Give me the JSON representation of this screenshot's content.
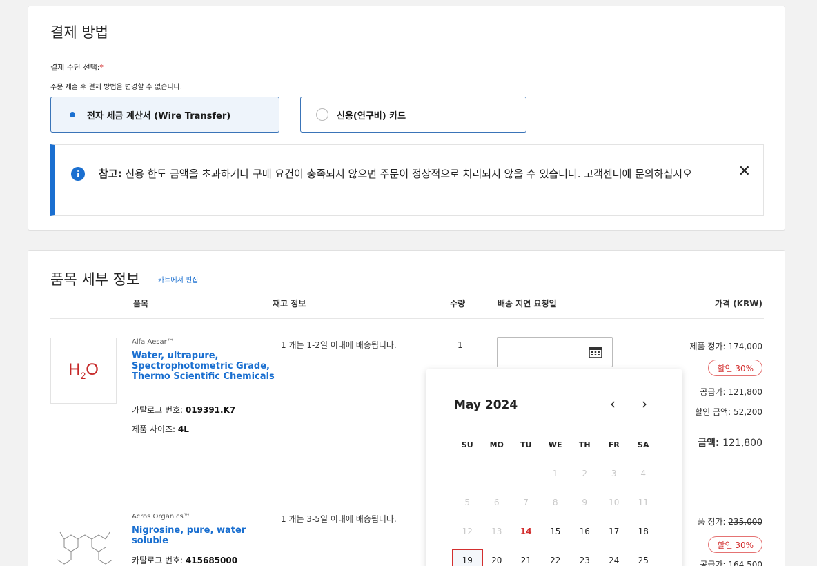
{
  "payment": {
    "title": "결제 방법",
    "select_label": "결제 수단 선택:",
    "required_mark": "*",
    "note": "주문 제출 후 결제 방법을 변경할 수 없습니다.",
    "option_wire": "전자 세금 계산서 (Wire Transfer)",
    "option_card": "신용(연구비) 카드",
    "notice_label": "참고:",
    "notice_text": "신용 한도 금액을 초과하거나 구매 요건이 충족되지 않으면 주문이 정상적으로 처리되지 않을 수 있습니다. 고객센터에 문의하십시오",
    "close_glyph": "✕",
    "info_glyph": "i"
  },
  "items": {
    "title": "품목 세부 정보",
    "edit_link": "카트에서 편집",
    "headers": {
      "item": "품목",
      "stock": "재고 정보",
      "qty": "수량",
      "delivery": "배송 지연 요청일",
      "price": "가격 (KRW)"
    },
    "products": [
      {
        "brand": "Alfa Aesar™",
        "name": "Water, ultrapure, Spectrophotometric Grade, Thermo Scientific Chemicals",
        "catalog_label": "카탈로그 번호:",
        "catalog": "019391.K7",
        "size_label": "제품 사이즈:",
        "size": "4L",
        "stock": "1 개는 1-2일 이내에 배송됩니다.",
        "qty": "1",
        "list_label": "제품 정가:",
        "list_price": "174,000",
        "discount": "할인 30%",
        "supply_label": "공급가:",
        "supply": "121,800",
        "discount_amt_label": "할인 금액:",
        "discount_amt": "52,200",
        "total_label": "금액:",
        "total": "121,800"
      },
      {
        "brand": "Acros Organics™",
        "name": "Nigrosine, pure, water soluble",
        "catalog_label": "카탈로그 번호:",
        "catalog": "415685000",
        "stock": "1 개는 3-5일 이내에 배송됩니다.",
        "list_label": "품 정가:",
        "list_price": "235,000",
        "discount": "할인 30%",
        "supply_label": "공급가:",
        "supply": "164,500"
      }
    ]
  },
  "calendar": {
    "month": "May 2024",
    "prev": "‹",
    "next": "›",
    "weekdays": [
      "SU",
      "MO",
      "TU",
      "WE",
      "TH",
      "FR",
      "SA"
    ],
    "weeks": [
      [
        "",
        "",
        "",
        "1",
        "2",
        "3",
        "4"
      ],
      [
        "5",
        "6",
        "7",
        "8",
        "9",
        "10",
        "11"
      ],
      [
        "12",
        "13",
        "14",
        "15",
        "16",
        "17",
        "18"
      ],
      [
        "19",
        "20",
        "21",
        "22",
        "23",
        "24",
        "25"
      ]
    ],
    "today": "14",
    "selected": "19",
    "last_disabled": "13"
  },
  "colors": {
    "accent": "#1a6fd0",
    "discount": "#d32f2f"
  }
}
